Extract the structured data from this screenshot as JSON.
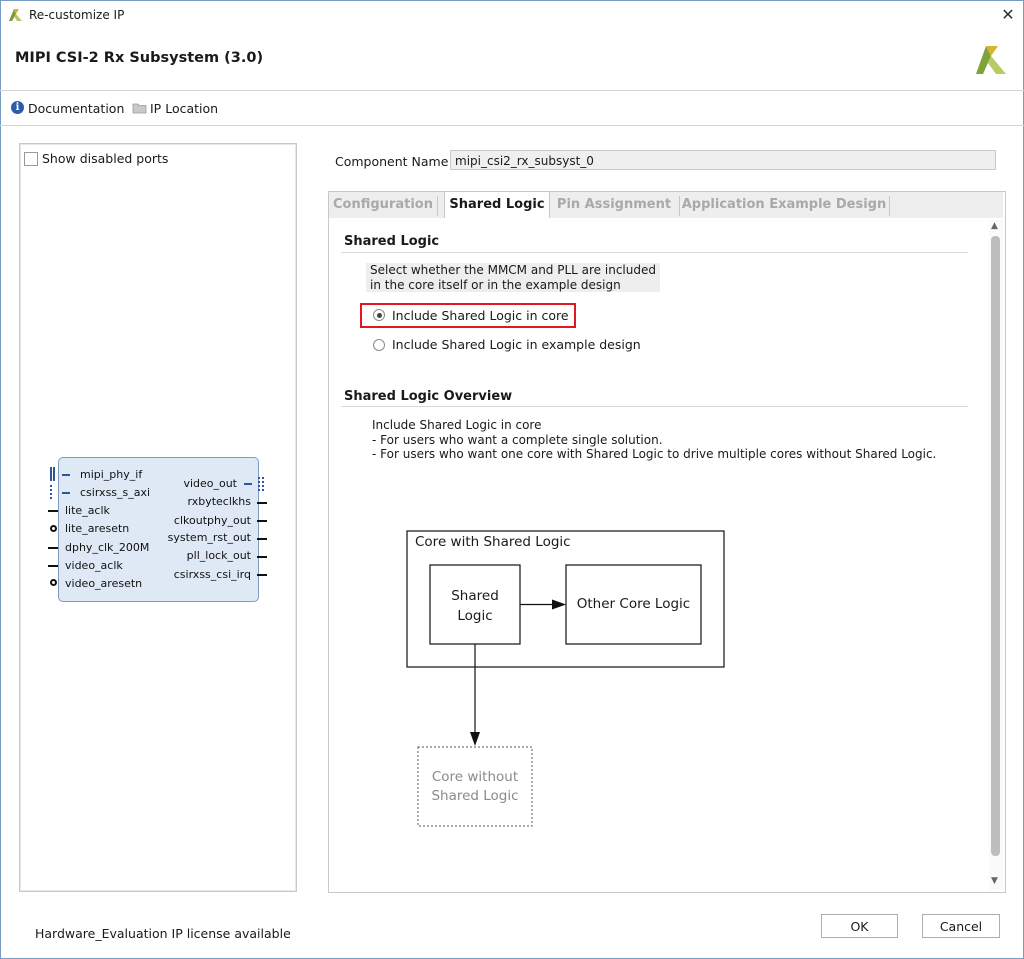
{
  "window": {
    "title": "Re-customize IP",
    "close_icon": "close-icon"
  },
  "header": {
    "ip_name": "MIPI CSI-2 Rx Subsystem (3.0)"
  },
  "links": {
    "documentation": "Documentation",
    "ip_location": "IP Location"
  },
  "left_panel": {
    "show_disabled_ports": "Show disabled ports",
    "block": {
      "left_ports": [
        "mipi_phy_if",
        "csirxss_s_axi",
        "lite_aclk",
        "lite_aresetn",
        "dphy_clk_200M",
        "video_aclk",
        "video_aresetn"
      ],
      "right_ports": [
        "video_out",
        "rxbyteclkhs",
        "clkoutphy_out",
        "system_rst_out",
        "pll_lock_out",
        "csirxss_csi_irq"
      ]
    }
  },
  "component": {
    "label": "Component Name",
    "value": "mipi_csi2_rx_subsyst_0"
  },
  "tabs": [
    {
      "label": "Configuration",
      "active": false
    },
    {
      "label": "Shared Logic",
      "active": true
    },
    {
      "label": "Pin Assignment",
      "active": false
    },
    {
      "label": "Application Example Design",
      "active": false
    }
  ],
  "shared_logic": {
    "title": "Shared Logic",
    "description_line1": "Select whether the MMCM and PLL are included",
    "description_line2": "in the core itself or in the example design",
    "option_core": "Include Shared Logic in core",
    "option_example": "Include Shared Logic in example design",
    "selected": "Include Shared Logic in core"
  },
  "overview": {
    "title": "Shared Logic Overview",
    "line1": "Include Shared Logic in core",
    "line2": "- For users who want a complete single solution.",
    "line3": "- For users who want one core with Shared Logic to drive multiple cores without Shared Logic."
  },
  "diagram": {
    "outer_label": "Core with Shared Logic",
    "shared_line1": "Shared",
    "shared_line2": "Logic",
    "other_core": "Other Core Logic",
    "without_line1": "Core without",
    "without_line2": "Shared Logic"
  },
  "footer": {
    "license": "Hardware_Evaluation IP license available",
    "ok": "OK",
    "cancel": "Cancel"
  },
  "colors": {
    "highlight": "#e2171f",
    "block_fill": "#dfe9f5",
    "logo_green": "#8ab33f"
  }
}
